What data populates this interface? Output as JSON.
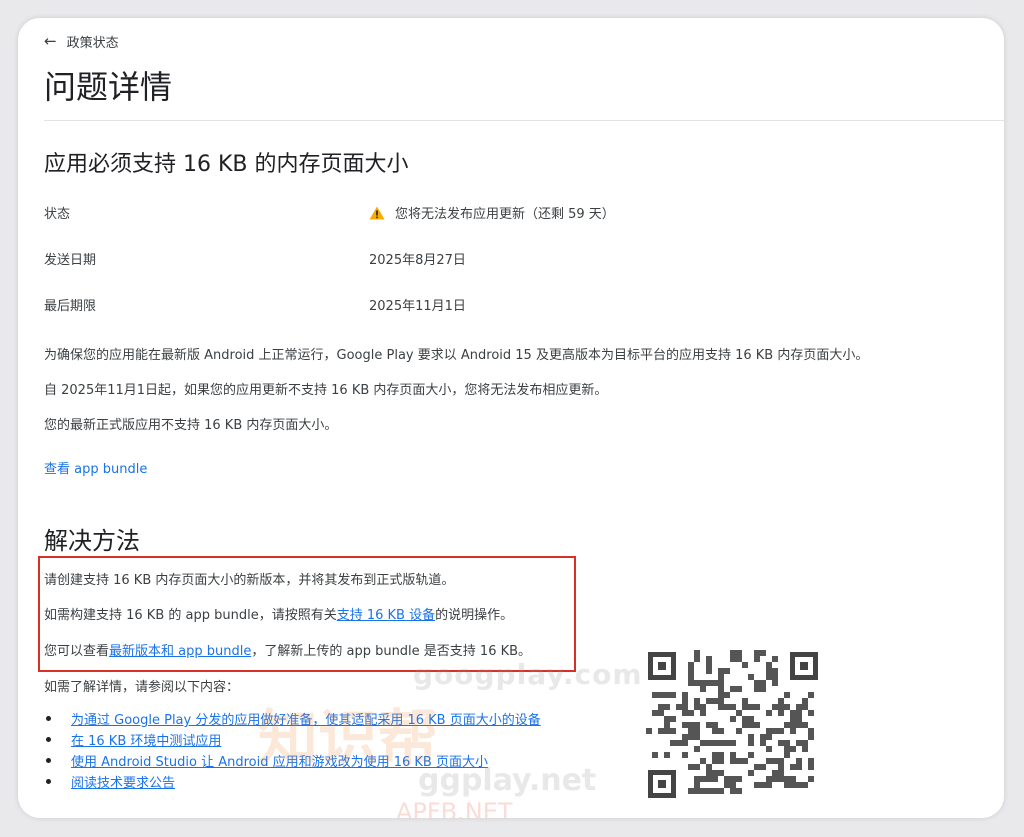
{
  "nav": {
    "back_label": "政策状态"
  },
  "page_title": "问题详情",
  "issue": {
    "title": "应用必须支持 16 KB 的内存页面大小",
    "rows": [
      {
        "label": "状态",
        "value": "您将无法发布应用更新（还剩 59 天）"
      },
      {
        "label": "发送日期",
        "value": "2025年8月27日"
      },
      {
        "label": "最后期限",
        "value": "2025年11月1日"
      }
    ],
    "paragraphs": [
      "为确保您的应用能在最新版 Android 上正常运行，Google Play 要求以 Android 15 及更高版本为目标平台的应用支持 16 KB 内存页面大小。",
      "自 2025年11月1日起，如果您的应用更新不支持 16 KB 内存页面大小，您将无法发布相应更新。",
      "您的最新正式版应用不支持 16 KB 内存页面大小。"
    ],
    "view_bundle_link": "查看 app bundle"
  },
  "solution": {
    "title": "解决方法",
    "line1": "请创建支持 16 KB 内存页面大小的新版本，并将其发布到正式版轨道。",
    "line2_pre": "如需构建支持 16 KB 的 app bundle，请按照有关",
    "line2_link": "支持 16 KB 设备",
    "line2_post": "的说明操作。",
    "line3_pre": "您可以查看",
    "line3_link": "最新版本和 app bundle",
    "line3_post": "，了解新上传的 app bundle 是否支持 16 KB。"
  },
  "more_info": {
    "intro": "如需了解详情，请参阅以下内容：",
    "links": [
      "为通过 Google Play 分发的应用做好准备，使其适配采用 16 KB 页面大小的设备",
      "在 16 KB 环境中测试应用",
      "使用 Android Studio 让 Android 应用和游戏改为使用 16 KB 页面大小",
      "阅读技术要求公告"
    ]
  },
  "watermarks": [
    "googplay.com",
    "知识帮",
    "ggplay.net",
    "APFB.NET"
  ],
  "colors": {
    "link": "#1a73e8",
    "highlight_border": "#d93025",
    "warning": "#f9ab00"
  },
  "icons": {
    "back": "arrow-left-icon",
    "status": "warning-icon"
  }
}
